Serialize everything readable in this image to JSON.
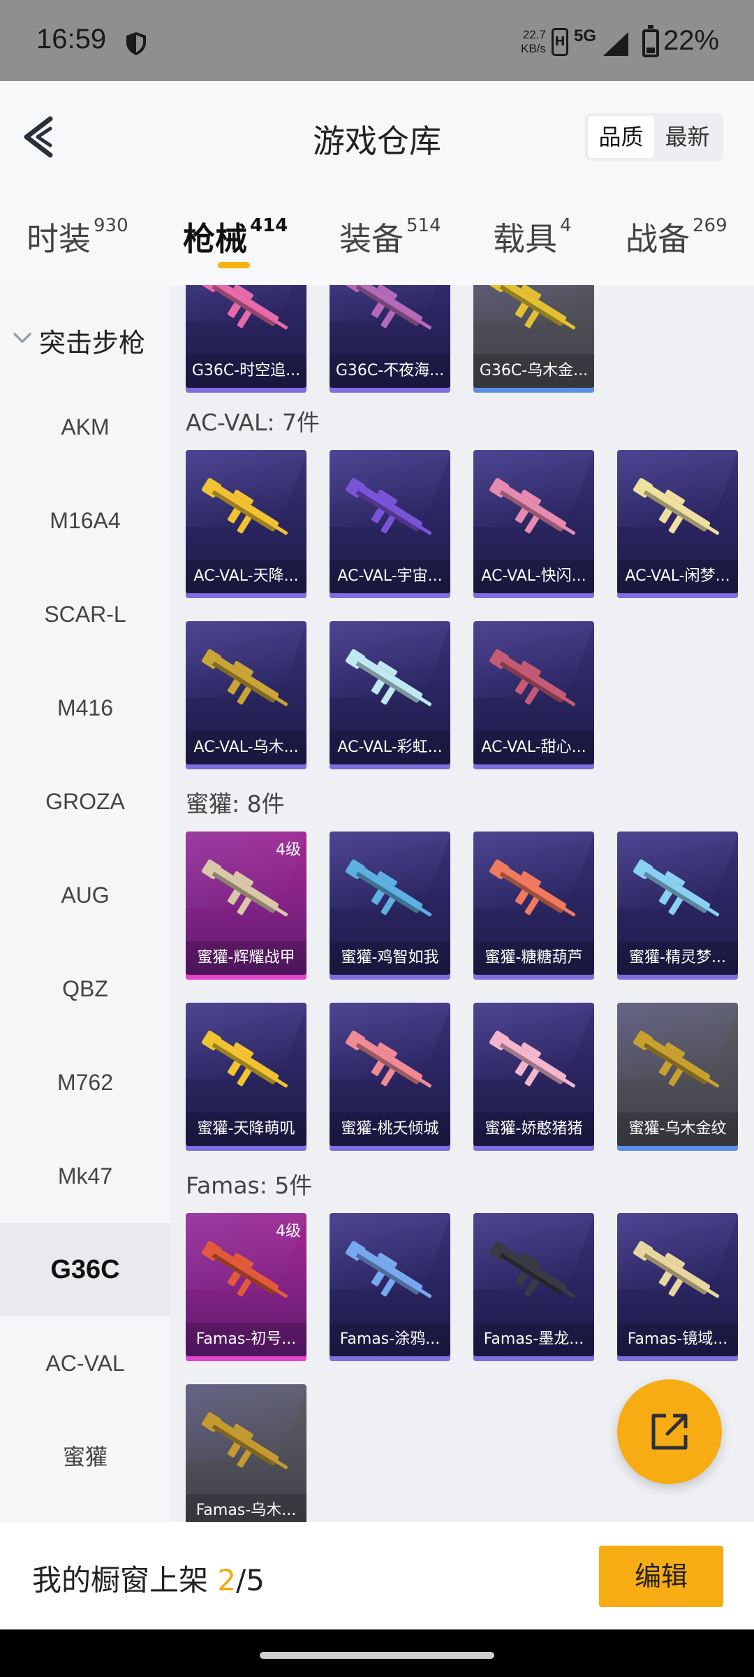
{
  "status_bar": {
    "time": "16:59",
    "net_speed_value": "22.7",
    "net_speed_unit": "KB/s",
    "hd_label": "H",
    "network_type": "5G",
    "battery_level": "22%"
  },
  "header": {
    "title": "游戏仓库",
    "sort_options": [
      "品质",
      "最新"
    ],
    "sort_selected": "品质"
  },
  "tabs": [
    {
      "label": "时装",
      "count": "930"
    },
    {
      "label": "枪械",
      "count": "414"
    },
    {
      "label": "装备",
      "count": "514"
    },
    {
      "label": "载具",
      "count": "4"
    },
    {
      "label": "战备",
      "count": "269"
    }
  ],
  "active_tab": "枪械",
  "sidebar": {
    "group_label": "突击步枪",
    "items": [
      "AKM",
      "M16A4",
      "SCAR-L",
      "M416",
      "GROZA",
      "AUG",
      "QBZ",
      "M762",
      "Mk47",
      "G36C",
      "AC-VAL",
      "蜜獾"
    ],
    "active_item": "G36C"
  },
  "sections": [
    {
      "title": "",
      "items": [
        {
          "name": "G36C-时空追...",
          "rarity": "purple",
          "gun_color": "#e86aa8"
        },
        {
          "name": "G36C-不夜海...",
          "rarity": "purple",
          "gun_color": "#b46ab8"
        },
        {
          "name": "G36C-乌木金...",
          "rarity": "grey",
          "gun_color": "#e2c032"
        }
      ]
    },
    {
      "title": "AC-VAL: 7件",
      "items": [
        {
          "name": "AC-VAL-天降...",
          "rarity": "purple",
          "gun_color": "#f1c232"
        },
        {
          "name": "AC-VAL-宇宙...",
          "rarity": "purple",
          "gun_color": "#7a54d8"
        },
        {
          "name": "AC-VAL-快闪...",
          "rarity": "purple",
          "gun_color": "#e58bb0"
        },
        {
          "name": "AC-VAL-闲梦...",
          "rarity": "purple",
          "gun_color": "#efe0a0"
        },
        {
          "name": "AC-VAL-乌木...",
          "rarity": "purple",
          "gun_color": "#c9a436"
        },
        {
          "name": "AC-VAL-彩虹...",
          "rarity": "purple",
          "gun_color": "#bfe8f0"
        },
        {
          "name": "AC-VAL-甜心...",
          "rarity": "purple",
          "gun_color": "#c65a74"
        }
      ]
    },
    {
      "title": "蜜獾: 8件",
      "items": [
        {
          "name": "蜜獾-辉耀战甲",
          "rarity": "pink",
          "level": "4级",
          "gun_color": "#d9c8a8"
        },
        {
          "name": "蜜獾-鸡智如我",
          "rarity": "purple",
          "gun_color": "#5db0e0"
        },
        {
          "name": "蜜獾-糖糖葫芦",
          "rarity": "purple",
          "gun_color": "#f07a5e"
        },
        {
          "name": "蜜獾-精灵梦...",
          "rarity": "purple",
          "gun_color": "#8ad0f0"
        },
        {
          "name": "蜜獾-天降萌叽",
          "rarity": "purple",
          "gun_color": "#f0c430"
        },
        {
          "name": "蜜獾-桃夭倾城",
          "rarity": "purple",
          "gun_color": "#f08a94"
        },
        {
          "name": "蜜獾-娇憨猪猪",
          "rarity": "purple",
          "gun_color": "#f4b6cc"
        },
        {
          "name": "蜜獾-乌木金纹",
          "rarity": "grey",
          "gun_color": "#c8a030"
        }
      ]
    },
    {
      "title": "Famas: 5件",
      "items": [
        {
          "name": "Famas-初号...",
          "rarity": "pink",
          "level": "4级",
          "gun_color": "#e25a3a"
        },
        {
          "name": "Famas-涂鸦...",
          "rarity": "purple",
          "gun_color": "#78a8f0"
        },
        {
          "name": "Famas-墨龙...",
          "rarity": "purple",
          "gun_color": "#3a3a44"
        },
        {
          "name": "Famas-镜域...",
          "rarity": "purple",
          "gun_color": "#e8d6a0"
        },
        {
          "name": "Famas-乌木...",
          "rarity": "grey",
          "gun_color": "#c49a30"
        }
      ]
    }
  ],
  "bottom_bar": {
    "showcase_label": "我的橱窗上架 ",
    "showcase_current": "2",
    "showcase_total": "/5",
    "edit_label": "编辑"
  },
  "colors": {
    "accent": "#f6ac12",
    "purple_card": "#2a2560",
    "pink_card": "#a8288e",
    "grey_card": "#4b4c53"
  }
}
